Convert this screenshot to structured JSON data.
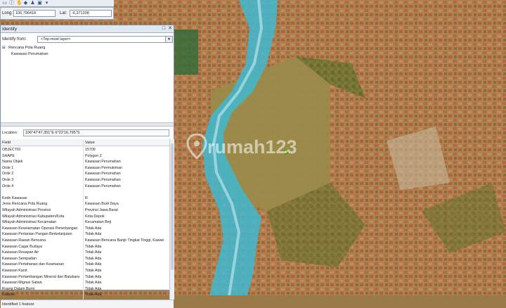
{
  "toolbar": {
    "icons": [
      "select-tool-icon",
      "info-tool-icon",
      "hand-tool-icon",
      "measure-tool-icon",
      "marker-icon",
      "window-icon",
      "dropdown-icon"
    ]
  },
  "coords": {
    "long_label": "Long:",
    "long_value": "106,796418",
    "lat_label": "Lat:",
    "lat_value": "-6,371208"
  },
  "identify": {
    "title": "Identify",
    "from_label": "Identify from:",
    "from_value": "<Top-most layer>",
    "tree": [
      {
        "label": "Rencana Pola Ruang",
        "toggle": "⊟"
      },
      {
        "label": "Kawasan Perumahan",
        "toggle": ""
      }
    ],
    "location_label": "Location:",
    "location_value": "106°47'47,351\"E  6°22'16,795\"S",
    "col_field": "Field",
    "col_value": "Value",
    "rows": [
      {
        "f": "OBJECTID",
        "v": "15709"
      },
      {
        "f": "SHAPE",
        "v": "Polygon Z"
      },
      {
        "f": "Nama Objek",
        "v": "Kawasan Perumahan"
      },
      {
        "f": "Orde 1",
        "v": "Kawasan Permukiman"
      },
      {
        "f": "Orde 2",
        "v": "Kawasan Perumahan"
      },
      {
        "f": "Orde 3",
        "v": "Kawasan Perumahan"
      },
      {
        "f": "Orde 4",
        "v": "Kawasan Perumahan"
      },
      {
        "f": "",
        "v": ""
      },
      {
        "f": "Kode Kawasan",
        "v": "R"
      },
      {
        "f": "Jenis Rencana Pola Ruang",
        "v": "Kawasan Budi Daya"
      },
      {
        "f": "Wilayah Administrasi Provinsi",
        "v": "Provinsi Jawa Barat"
      },
      {
        "f": "Wilayah Administrasi Kabupaten/Kota",
        "v": "Kota Depok"
      },
      {
        "f": "Wilayah Administrasi Kecamatan",
        "v": "Kecamatan Beji"
      },
      {
        "f": "Kawasan Keselamatan Operasi Penerbangan",
        "v": "Tidak Ada"
      },
      {
        "f": "Kawasan Pertanian Pangan Berkelanjutan",
        "v": "Tidak Ada"
      },
      {
        "f": "Kawasan Rawan Bencana",
        "v": "Kawasan Bencana Banjir Tingkat Tinggi, Kawan"
      },
      {
        "f": "Kawasan Cagar Budaya",
        "v": "Tidak Ada"
      },
      {
        "f": "Kawasan Resapan Air",
        "v": "Tidak Ada"
      },
      {
        "f": "Kawasan Sempadan",
        "v": "Tidak Ada"
      },
      {
        "f": "Kawasan Pertahanan dan Keamanan",
        "v": "Tidak Ada"
      },
      {
        "f": "Kawasan Karst",
        "v": "Tidak Ada"
      },
      {
        "f": "Kawasan Pertambangan Mineral dan Batubara",
        "v": "Tidak Ada"
      },
      {
        "f": "Kawasan Migrasi Satwa",
        "v": "Tidak Ada"
      },
      {
        "f": "Ruang Dalam Bumi",
        "v": "Tidak Ada"
      },
      {
        "f": "Catatan",
        "v": "Tidak Ada"
      }
    ],
    "status": "Identified 1 feature"
  },
  "watermark": {
    "text": "rumah123"
  },
  "colors": {
    "river": "#3fb8d0",
    "highlight": "#2e6b3a",
    "marker": "#6cff3a"
  }
}
